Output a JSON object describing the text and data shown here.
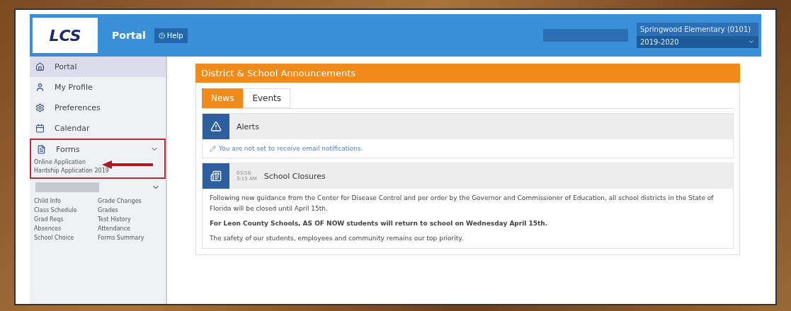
{
  "header": {
    "logo": "LCS",
    "title": "Portal",
    "help": "Help",
    "school": "Springwood Elementary (0101)",
    "year": "2019-2020"
  },
  "sidebar": {
    "items": [
      {
        "label": "Portal",
        "selected": true
      },
      {
        "label": "My Profile",
        "selected": false
      },
      {
        "label": "Preferences",
        "selected": false
      },
      {
        "label": "Calendar",
        "selected": false
      }
    ],
    "forms": {
      "label": "Forms",
      "expanded": true,
      "links": [
        "Online Application",
        "Hardship Application 2019"
      ]
    },
    "student_links": [
      "Child Info",
      "Grade Changes",
      "Class Schedule",
      "Grades",
      "Grad Reqs",
      "Test History",
      "Absences",
      "Attendance",
      "School Choice",
      "Forms Summary"
    ]
  },
  "panel": {
    "title": "District & School Announcements",
    "tabs": [
      {
        "label": "News",
        "selected": true
      },
      {
        "label": "Events",
        "selected": false
      }
    ],
    "alerts": {
      "title": "Alerts",
      "message": "You are not set to receive email notifications."
    },
    "post": {
      "date": "03/16",
      "time": "3:15 AM",
      "title": "School Closures",
      "paragraphs": [
        {
          "text": "Following new guidance from the Center for Disease Control and per order by the Governor and Commissioner of Education, all school districts in the State of Florida will be closed until April 15th.",
          "bold": false
        },
        {
          "text": "For Leon County Schools,  AS OF NOW students will return to school on Wednesday April 15th.",
          "bold": true
        },
        {
          "text": "The safety of our students, employees and community remains our top priority.",
          "bold": false
        }
      ]
    }
  }
}
